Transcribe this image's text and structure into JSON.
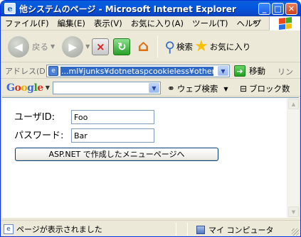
{
  "window": {
    "title": "他システムのページ - Microsoft Internet Explorer",
    "title_icon": "ie-page-icon",
    "controls": [
      "minimize",
      "maximize",
      "close"
    ]
  },
  "menu": {
    "items": [
      "ファイル(F)",
      "編集(E)",
      "表示(V)",
      "お気に入り(A)",
      "ツール(T)",
      "ヘルプ"
    ],
    "overflow": "»"
  },
  "toolbar": {
    "back_label": "戻る",
    "search_label": "検索",
    "favorites_label": "お気に入り"
  },
  "address": {
    "label": "アドレス(D)",
    "url": "...ml¥junks¥dotnetaspcookieless¥other.htm",
    "go_label": "移動",
    "links_label": "リンク"
  },
  "google": {
    "logo": "Google",
    "search_label": "ウェブ検索",
    "block_label": "ブロック数"
  },
  "form": {
    "userid_label": "ユーザID:",
    "userid_value": "Foo",
    "password_label": "パスワード:",
    "password_value": "Bar",
    "submit_label": "ASP.NET で作成したメニューページへ"
  },
  "status": {
    "text": "ページが表示されました",
    "zone": "マイ コンピュータ"
  },
  "colors": {
    "titlebar": "#0458e0",
    "chrome": "#ece9d8",
    "selection": "#316ac5"
  }
}
